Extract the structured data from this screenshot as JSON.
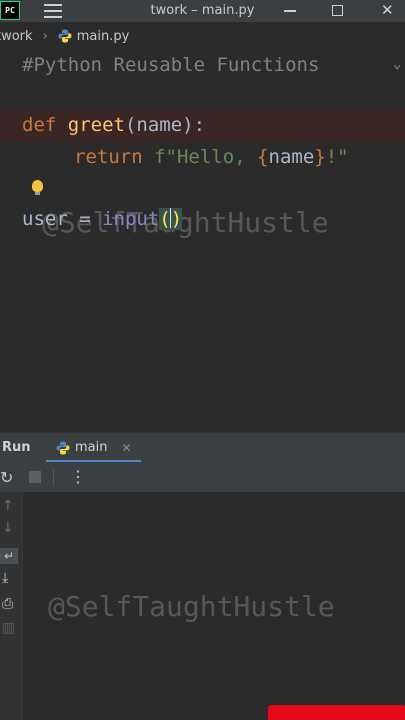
{
  "window": {
    "title": "twork – main.py",
    "logo_text": "PC"
  },
  "breadcrumb": {
    "project": "twork",
    "file": "main.py"
  },
  "editor": {
    "comment": "#Python Reusable Functions",
    "def_keyword": "def",
    "func_name": "greet",
    "params": "(name):",
    "return_keyword": "return",
    "fstring_prefix": "f\"Hello, ",
    "fstring_open": "{",
    "fstring_var": "name",
    "fstring_close": "}",
    "fstring_suffix": "!\"",
    "assign_lhs": "user = ",
    "builtin": "input",
    "paren_open": "(",
    "paren_close": ")"
  },
  "run_panel": {
    "title": "Run",
    "tab_label": "main"
  },
  "watermark": "@SelfTaughtHustle",
  "colors": {
    "keyword": "#cc7832",
    "function": "#ffc66d",
    "string": "#6a8759",
    "builtin": "#8888c6",
    "accent": "#4a88c7",
    "brand_red": "#e5091a"
  }
}
